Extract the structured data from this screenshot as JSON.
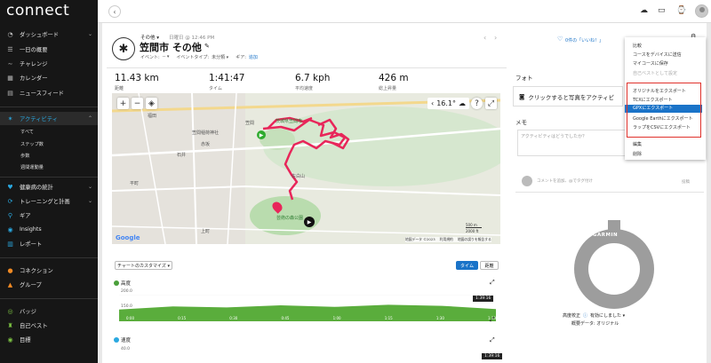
{
  "brand": {
    "logo": "connect"
  },
  "sidebar": {
    "items": [
      {
        "name": "dashboard",
        "label": "ダッシュボード",
        "icon": "dashboard-icon",
        "chev": true
      },
      {
        "name": "daily-summary",
        "label": "一日の概要",
        "icon": "layers-icon",
        "chev": false
      },
      {
        "name": "challenge",
        "label": "チャレンジ",
        "icon": "challenge-icon",
        "chev": false
      },
      {
        "name": "calendar",
        "label": "カレンダー",
        "icon": "calendar-icon",
        "chev": false
      },
      {
        "name": "newsfeed",
        "label": "ニュースフィード",
        "icon": "news-icon",
        "chev": false
      },
      {
        "name": "activities",
        "label": "アクティビティ",
        "icon": "running-icon",
        "chev": true
      },
      {
        "name": "health-stats",
        "label": "健康病の統計",
        "icon": "heart-icon",
        "chev": true
      },
      {
        "name": "training",
        "label": "トレーニングと計画",
        "icon": "training-icon",
        "chev": true
      },
      {
        "name": "gear",
        "label": "ギア",
        "icon": "shoe-icon",
        "chev": false
      },
      {
        "name": "insights",
        "label": "Insights",
        "icon": "insights-icon",
        "chev": false
      },
      {
        "name": "reports",
        "label": "レポート",
        "icon": "report-icon",
        "chev": false
      },
      {
        "name": "connections",
        "label": "コネクション",
        "icon": "people-icon",
        "chev": false
      },
      {
        "name": "groups",
        "label": "グループ",
        "icon": "group-icon",
        "chev": false
      },
      {
        "name": "badges",
        "label": "バッジ",
        "icon": "badge-icon",
        "chev": false
      },
      {
        "name": "personal-records",
        "label": "自己ベスト",
        "icon": "trophy-icon",
        "chev": false
      },
      {
        "name": "goals",
        "label": "目標",
        "icon": "goal-icon",
        "chev": false
      }
    ],
    "subitems": [
      "すべて",
      "ステップ数",
      "歩数",
      "週間運動量"
    ]
  },
  "activity": {
    "type_label": "その他 ▾",
    "date": "日曜日 @ 12:46 PM",
    "title": "笠間市 その他",
    "event_label": "イベント:",
    "event_value": "-- ▾",
    "event_type_label": "イベントタイプ:",
    "event_type_value": "未分類 ▾",
    "gear_label": "ギア:",
    "gear_value": "追加",
    "likes": "0件の「いいね！」"
  },
  "stats": [
    {
      "value": "11.43 km",
      "label": "距離"
    },
    {
      "value": "1:41:47",
      "label": "タイム"
    },
    {
      "value": "6.7 kph",
      "label": "平均速度"
    },
    {
      "value": "426 m",
      "label": "総上昇量"
    }
  ],
  "map": {
    "temp": "16.1°",
    "scale_m": "500 m",
    "scale_ft": "2000 ft",
    "attribution": "地図データ ©2023",
    "terms": "利用規約",
    "report": "地図の誤りを報告する",
    "google": "Google",
    "labels": [
      "茨城県笠間市",
      "笠間稲荷神社",
      "笠間",
      "福田",
      "佐白山",
      "芸術の森公園",
      "石井",
      "赤坂",
      "平町",
      "上町"
    ]
  },
  "photos": {
    "heading": "フォト",
    "cta": "クリックすると写真をアクティビ"
  },
  "memo": {
    "heading": "メモ",
    "placeholder": "アクティビティはどうでしたか？"
  },
  "comment": {
    "placeholder": "コメントを追加、@でタグ付け",
    "post": "投稿"
  },
  "chart_controls": {
    "customize": "チャートのカスタマイズ ▾",
    "time": "タイム",
    "distance": "距離"
  },
  "elevation_chart": {
    "title": "高度",
    "y_max": "200.0",
    "y_min": "150.0",
    "time_badge": "1:39:16",
    "chart_data": {
      "type": "area",
      "title": "高度",
      "ylim": [
        150,
        200
      ],
      "x": [
        "0:00",
        "0:15",
        "0:30",
        "0:45",
        "1:00",
        "1:15",
        "1:30",
        "1:39"
      ],
      "series": [
        {
          "values": [
            172,
            178,
            176,
            180,
            177,
            181,
            179,
            173
          ]
        }
      ]
    }
  },
  "speed_chart": {
    "title": "速度",
    "y_max": "40.0",
    "time_badge": "1:39:16"
  },
  "dropdown": {
    "items": [
      {
        "label": "比較",
        "state": "normal"
      },
      {
        "label": "コースをデバイスに送信",
        "state": "normal"
      },
      {
        "label": "マイコースに保存",
        "state": "normal"
      },
      {
        "label": "自己ベストとして設定",
        "state": "disabled"
      },
      {
        "label": "オリジナルをエクスポート",
        "state": "normal"
      },
      {
        "label": "TCXにエクスポート",
        "state": "normal"
      },
      {
        "label": "GPXにエクスポート",
        "state": "highlight"
      },
      {
        "label": "Google Earthにエクスポート",
        "state": "normal"
      },
      {
        "label": "ラップをCSVにエクスポート",
        "state": "normal"
      },
      {
        "label": "編集",
        "state": "normal"
      },
      {
        "label": "削除",
        "state": "normal"
      }
    ]
  },
  "device": {
    "brand": "GARMIN",
    "altitude_calibration": "高度校正",
    "calibration_value": "有効にしました ▾",
    "elevation_data": "概要データ: オリジナル"
  }
}
